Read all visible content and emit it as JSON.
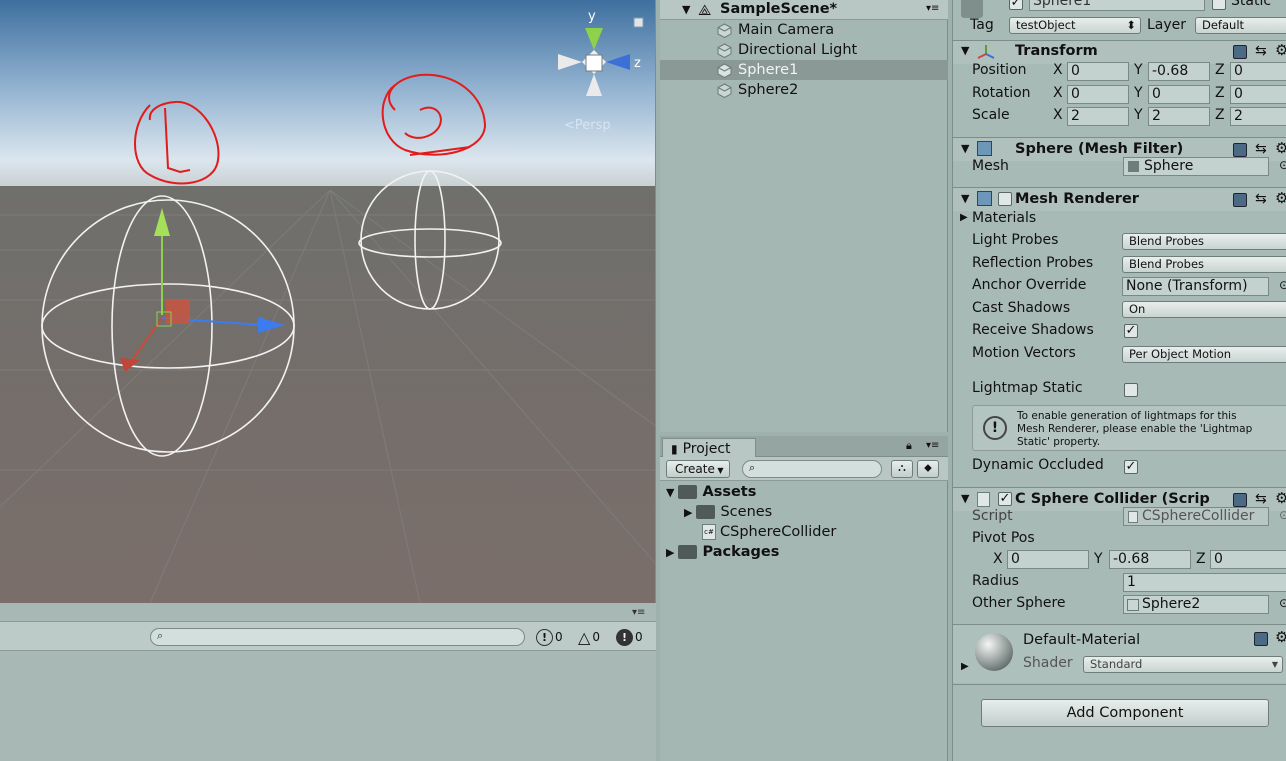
{
  "scene": {
    "persp_label": "<Persp",
    "axis_y": "y",
    "axis_z": "z"
  },
  "console": {
    "info_count": "0",
    "warn_count": "0",
    "error_count": "0"
  },
  "hierarchy": {
    "scene_name": "SampleScene*",
    "items": [
      {
        "label": "Main Camera"
      },
      {
        "label": "Directional Light"
      },
      {
        "label": "Sphere1"
      },
      {
        "label": "Sphere2"
      }
    ]
  },
  "project": {
    "tab": "Project",
    "create_label": "Create",
    "tree": {
      "assets": "Assets",
      "scenes": "Scenes",
      "script": "CSphereCollider",
      "packages": "Packages"
    }
  },
  "inspector": {
    "object_name": "Sphere1",
    "static_label": "Static",
    "tag_label": "Tag",
    "tag_value": "testObject",
    "layer_label": "Layer",
    "layer_value": "Default",
    "transform": {
      "title": "Transform",
      "rows": [
        {
          "label": "Position",
          "x": "0",
          "y": "-0.68",
          "z": "0"
        },
        {
          "label": "Rotation",
          "x": "0",
          "y": "0",
          "z": "0"
        },
        {
          "label": "Scale",
          "x": "2",
          "y": "2",
          "z": "2"
        }
      ],
      "x": "X",
      "y": "Y",
      "z": "Z"
    },
    "mesh_filter": {
      "title": "Sphere (Mesh Filter)",
      "mesh_label": "Mesh",
      "mesh_value": "Sphere"
    },
    "mesh_renderer": {
      "title": "Mesh Renderer",
      "materials": "Materials",
      "light_probes_label": "Light Probes",
      "light_probes_value": "Blend Probes",
      "reflection_probes_label": "Reflection Probes",
      "reflection_probes_value": "Blend Probes",
      "anchor_override_label": "Anchor Override",
      "anchor_override_value": "None (Transform)",
      "cast_shadows_label": "Cast Shadows",
      "cast_shadows_value": "On",
      "receive_shadows_label": "Receive Shadows",
      "motion_vectors_label": "Motion Vectors",
      "motion_vectors_value": "Per Object Motion",
      "lightmap_static_label": "Lightmap Static",
      "info_line1": "To enable generation of lightmaps for this",
      "info_line2": "Mesh Renderer, please enable the 'Lightmap",
      "info_line3": "Static' property.",
      "dynamic_occluded_label": "Dynamic Occluded"
    },
    "sphere_collider": {
      "title": "C Sphere Collider (Scrip",
      "script_label": "Script",
      "script_value": "CSphereCollider",
      "pivot_label": "Pivot Pos",
      "pivot_x": "0",
      "pivot_y": "-0.68",
      "pivot_z": "0",
      "radius_label": "Radius",
      "radius_value": "1",
      "other_label": "Other Sphere",
      "other_value": "Sphere2"
    },
    "material": {
      "name": "Default-Material",
      "shader_label": "Shader",
      "shader_value": "Standard"
    },
    "add_component": "Add Component"
  }
}
